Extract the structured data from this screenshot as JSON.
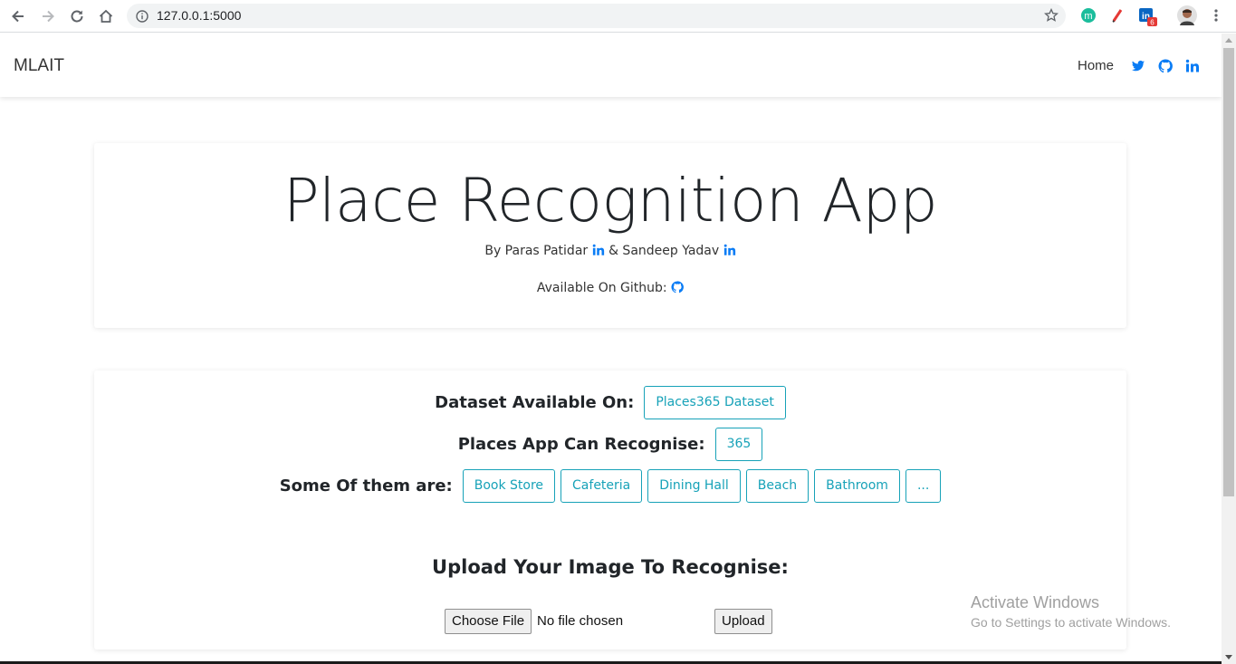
{
  "browser": {
    "url": "127.0.0.1:5000",
    "extension_badge_count": "6"
  },
  "navbar": {
    "brand": "MLAIT",
    "home_label": "Home"
  },
  "hero": {
    "title": "Place Recognition App",
    "by_prefix": "By Paras Patidar",
    "and_text": "& Sandeep Yadav",
    "github_label": "Available On Github:"
  },
  "info": {
    "dataset_label": "Dataset Available On:",
    "dataset_button": "Places365 Dataset",
    "recognise_label": "Places App Can Recognise:",
    "recognise_count": "365",
    "some_label": "Some Of them are:",
    "examples": [
      "Book Store",
      "Cafeteria",
      "Dining Hall",
      "Beach",
      "Bathroom",
      "..."
    ]
  },
  "upload": {
    "title": "Upload Your Image To Recognise:",
    "choose_file": "Choose File",
    "file_status": "No file chosen",
    "upload_button": "Upload"
  },
  "watermark": {
    "line1": "Activate Windows",
    "line2": "Go to Settings to activate Windows."
  },
  "colors": {
    "accent": "#17a2b8",
    "link_blue": "#0a7cf5"
  }
}
